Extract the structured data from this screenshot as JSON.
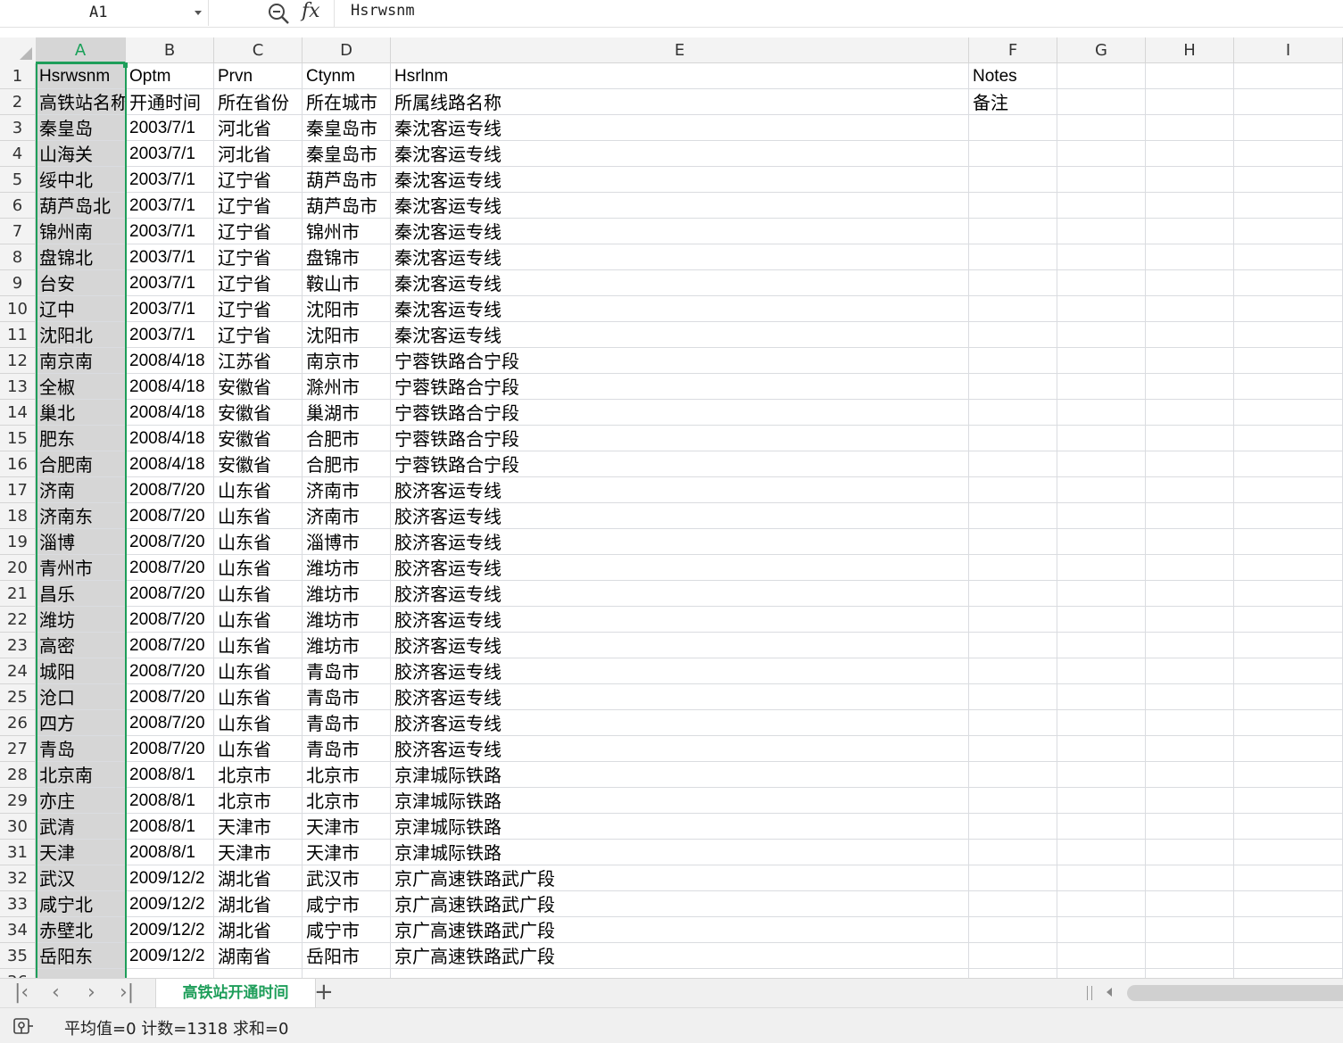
{
  "name_box": {
    "value": "A1"
  },
  "formula_bar": {
    "content": "Hsrwsnm"
  },
  "columns": [
    {
      "label": "A"
    },
    {
      "label": "B"
    },
    {
      "label": "C"
    },
    {
      "label": "D"
    },
    {
      "label": "E"
    },
    {
      "label": "F"
    },
    {
      "label": "G"
    },
    {
      "label": "H"
    },
    {
      "label": "I"
    }
  ],
  "rows": [
    [
      "Hsrwsnm",
      "Optm",
      "Prvn",
      "Ctynm",
      "Hsrlnm",
      "Notes"
    ],
    [
      "高铁站名称",
      "开通时间",
      "所在省份",
      "所在城市",
      "所属线路名称",
      "备注"
    ],
    [
      "秦皇岛",
      "2003/7/1",
      "河北省",
      "秦皇岛市",
      "秦沈客运专线",
      ""
    ],
    [
      "山海关",
      "2003/7/1",
      "河北省",
      "秦皇岛市",
      "秦沈客运专线",
      ""
    ],
    [
      "绥中北",
      "2003/7/1",
      "辽宁省",
      "葫芦岛市",
      "秦沈客运专线",
      ""
    ],
    [
      "葫芦岛北",
      "2003/7/1",
      "辽宁省",
      "葫芦岛市",
      "秦沈客运专线",
      ""
    ],
    [
      "锦州南",
      "2003/7/1",
      "辽宁省",
      "锦州市",
      "秦沈客运专线",
      ""
    ],
    [
      "盘锦北",
      "2003/7/1",
      "辽宁省",
      "盘锦市",
      "秦沈客运专线",
      ""
    ],
    [
      "台安",
      "2003/7/1",
      "辽宁省",
      "鞍山市",
      "秦沈客运专线",
      ""
    ],
    [
      "辽中",
      "2003/7/1",
      "辽宁省",
      "沈阳市",
      "秦沈客运专线",
      ""
    ],
    [
      "沈阳北",
      "2003/7/1",
      "辽宁省",
      "沈阳市",
      "秦沈客运专线",
      ""
    ],
    [
      "南京南",
      "2008/4/18",
      "江苏省",
      "南京市",
      "宁蓉铁路合宁段",
      ""
    ],
    [
      "全椒",
      "2008/4/18",
      "安徽省",
      "滁州市",
      "宁蓉铁路合宁段",
      ""
    ],
    [
      "巢北",
      "2008/4/18",
      "安徽省",
      "巢湖市",
      "宁蓉铁路合宁段",
      ""
    ],
    [
      "肥东",
      "2008/4/18",
      "安徽省",
      "合肥市",
      "宁蓉铁路合宁段",
      ""
    ],
    [
      "合肥南",
      "2008/4/18",
      "安徽省",
      "合肥市",
      "宁蓉铁路合宁段",
      ""
    ],
    [
      "济南",
      "2008/7/20",
      "山东省",
      "济南市",
      "胶济客运专线",
      ""
    ],
    [
      "济南东",
      "2008/7/20",
      "山东省",
      "济南市",
      "胶济客运专线",
      ""
    ],
    [
      "淄博",
      "2008/7/20",
      "山东省",
      "淄博市",
      "胶济客运专线",
      ""
    ],
    [
      "青州市",
      "2008/7/20",
      "山东省",
      "潍坊市",
      "胶济客运专线",
      ""
    ],
    [
      "昌乐",
      "2008/7/20",
      "山东省",
      "潍坊市",
      "胶济客运专线",
      ""
    ],
    [
      "潍坊",
      "2008/7/20",
      "山东省",
      "潍坊市",
      "胶济客运专线",
      ""
    ],
    [
      "高密",
      "2008/7/20",
      "山东省",
      "潍坊市",
      "胶济客运专线",
      ""
    ],
    [
      "城阳",
      "2008/7/20",
      "山东省",
      "青岛市",
      "胶济客运专线",
      ""
    ],
    [
      "沧口",
      "2008/7/20",
      "山东省",
      "青岛市",
      "胶济客运专线",
      ""
    ],
    [
      "四方",
      "2008/7/20",
      "山东省",
      "青岛市",
      "胶济客运专线",
      ""
    ],
    [
      "青岛",
      "2008/7/20",
      "山东省",
      "青岛市",
      "胶济客运专线",
      ""
    ],
    [
      "北京南",
      "2008/8/1",
      "北京市",
      "北京市",
      "京津城际铁路",
      ""
    ],
    [
      "亦庄",
      "2008/8/1",
      "北京市",
      "北京市",
      "京津城际铁路",
      ""
    ],
    [
      "武清",
      "2008/8/1",
      "天津市",
      "天津市",
      "京津城际铁路",
      ""
    ],
    [
      "天津",
      "2008/8/1",
      "天津市",
      "天津市",
      "京津城际铁路",
      ""
    ],
    [
      "武汉",
      "2009/12/2",
      "湖北省",
      "武汉市",
      "京广高速铁路武广段",
      ""
    ],
    [
      "咸宁北",
      "2009/12/2",
      "湖北省",
      "咸宁市",
      "京广高速铁路武广段",
      ""
    ],
    [
      "赤壁北",
      "2009/12/2",
      "湖北省",
      "咸宁市",
      "京广高速铁路武广段",
      ""
    ],
    [
      "岳阳东",
      "2009/12/2",
      "湖南省",
      "岳阳市",
      "京广高速铁路武广段",
      ""
    ]
  ],
  "sheet_tabs": [
    {
      "label": "高铁站开通时间",
      "active": true
    }
  ],
  "status_bar": {
    "text": "平均值=0  计数=1318  求和=0"
  },
  "colors": {
    "accent": "#1e9e5a",
    "selection_fill": "#d6d6d6",
    "header_bg": "#f3f3f3"
  }
}
